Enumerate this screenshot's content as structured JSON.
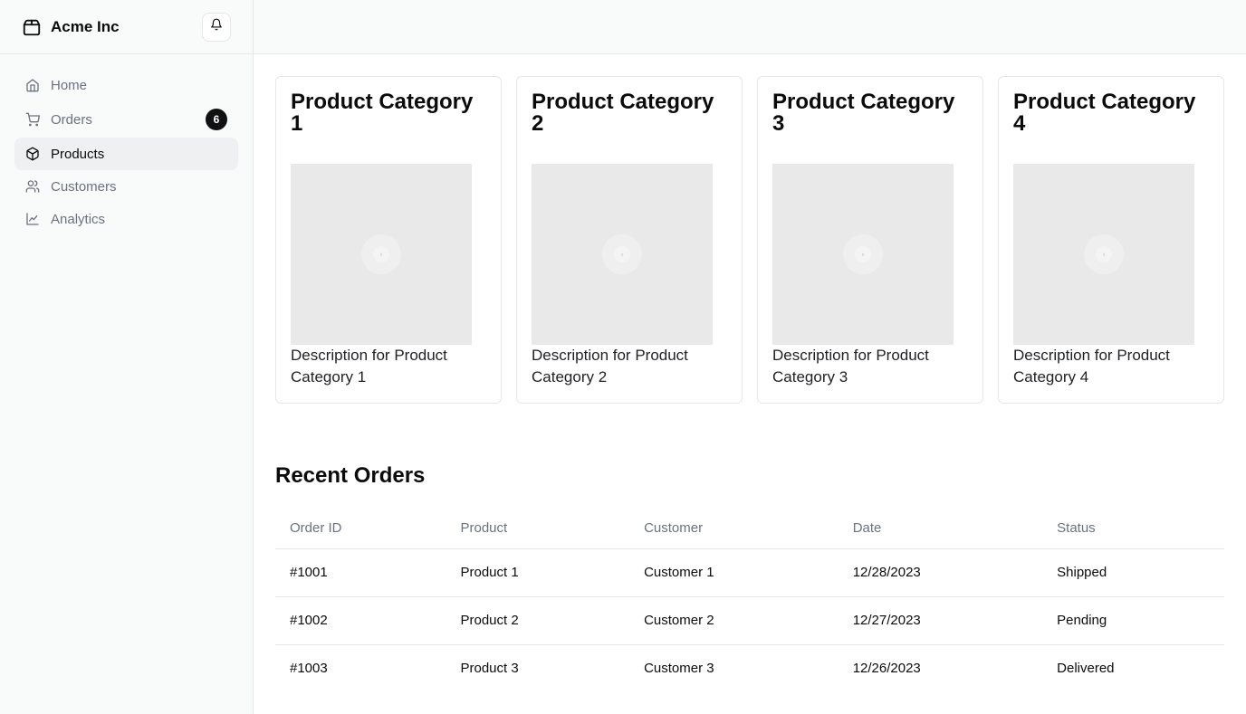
{
  "brand": {
    "name": "Acme Inc"
  },
  "nav": [
    {
      "label": "Home",
      "icon": "home-icon"
    },
    {
      "label": "Orders",
      "icon": "cart-icon",
      "badge": "6"
    },
    {
      "label": "Products",
      "icon": "package-icon",
      "active": true
    },
    {
      "label": "Customers",
      "icon": "users-icon"
    },
    {
      "label": "Analytics",
      "icon": "line-chart-icon"
    }
  ],
  "products": [
    {
      "title": "Product Category 1",
      "description": "Description for Product Category 1"
    },
    {
      "title": "Product Category 2",
      "description": "Description for Product Category 2"
    },
    {
      "title": "Product Category 3",
      "description": "Description for Product Category 3"
    },
    {
      "title": "Product Category 4",
      "description": "Description for Product Category 4"
    }
  ],
  "orders": {
    "title": "Recent Orders",
    "columns": [
      "Order ID",
      "Product",
      "Customer",
      "Date",
      "Status"
    ],
    "rows": [
      [
        "#1001",
        "Product 1",
        "Customer 1",
        "12/28/2023",
        "Shipped"
      ],
      [
        "#1002",
        "Product 2",
        "Customer 2",
        "12/27/2023",
        "Pending"
      ],
      [
        "#1003",
        "Product 3",
        "Customer 3",
        "12/26/2023",
        "Delivered"
      ]
    ]
  },
  "colors": {
    "accent_dark": "#111114",
    "sidebar_bg": "#f9fafa",
    "active_bg": "#eef0f2",
    "muted_text": "#6b7280"
  }
}
